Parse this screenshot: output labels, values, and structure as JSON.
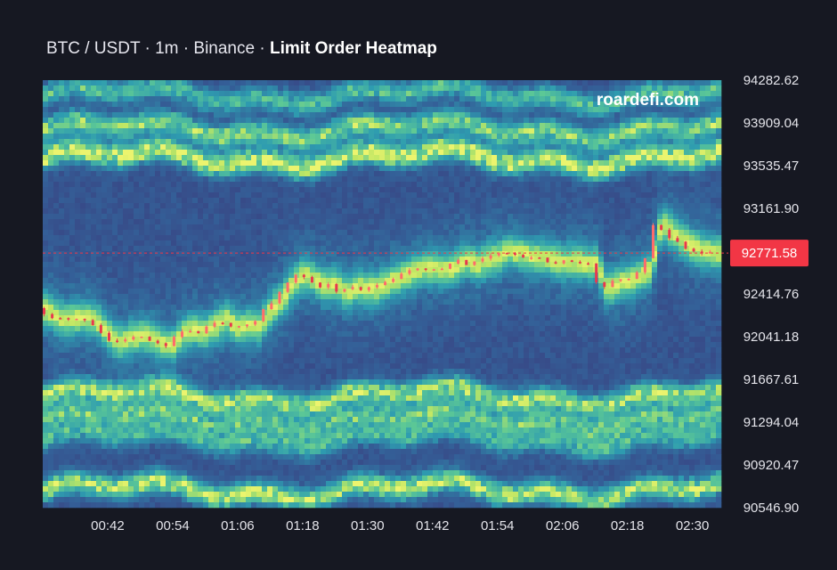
{
  "title": {
    "pair": "BTC / USDT",
    "sep1": " · ",
    "interval": "1m",
    "sep2": " · ",
    "exchange": "Binance",
    "sep3": " · ",
    "name": "Limit Order Heatmap"
  },
  "watermark": "roardefi.com",
  "colors": {
    "background": "#161822",
    "candle_up": "#ff6b6b",
    "candle_down": "#e8384f",
    "current_price_badge": "#f23645",
    "heat_low": "#3b3a7a",
    "heat_mid": "#2f9bb0",
    "heat_high": "#e6f26a"
  },
  "chart_data": {
    "type": "heatmap",
    "title": "BTC / USDT · 1m · Binance · Limit Order Heatmap",
    "ylim": [
      90546.9,
      94282.62
    ],
    "y_ticks": [
      "94282.62",
      "93909.04",
      "93535.47",
      "93161.90",
      "92414.76",
      "92041.18",
      "91667.61",
      "91294.04",
      "90920.47",
      "90546.90"
    ],
    "x_ticks": [
      "00:42",
      "00:54",
      "01:06",
      "01:18",
      "01:30",
      "01:42",
      "01:54",
      "02:06",
      "02:18",
      "02:30"
    ],
    "x_tick_minutes": [
      42,
      54,
      66,
      78,
      90,
      102,
      114,
      126,
      138,
      150
    ],
    "time_range_minutes": [
      30,
      155
    ],
    "current_price": 92771.58,
    "current_price_label": "92771.58",
    "price_series_minutes": [
      30,
      32,
      34,
      36,
      38,
      40,
      42,
      44,
      46,
      48,
      50,
      52,
      54,
      56,
      58,
      60,
      62,
      64,
      66,
      68,
      70,
      72,
      74,
      76,
      78,
      80,
      82,
      84,
      86,
      88,
      90,
      92,
      94,
      96,
      98,
      100,
      102,
      104,
      106,
      108,
      110,
      112,
      114,
      116,
      118,
      120,
      122,
      124,
      126,
      128,
      130,
      132,
      134,
      136,
      138,
      140,
      142,
      144,
      146,
      148,
      150,
      152,
      154
    ],
    "price_series": [
      92290,
      92230,
      92190,
      92200,
      92210,
      92180,
      92070,
      91990,
      92020,
      92050,
      92040,
      91980,
      91970,
      92070,
      92100,
      92080,
      92140,
      92190,
      92120,
      92140,
      92130,
      92270,
      92360,
      92490,
      92580,
      92550,
      92480,
      92500,
      92420,
      92480,
      92460,
      92470,
      92520,
      92560,
      92600,
      92640,
      92640,
      92620,
      92650,
      92710,
      92670,
      92710,
      92740,
      92790,
      92770,
      92740,
      92730,
      92710,
      92690,
      92700,
      92680,
      92680,
      92450,
      92510,
      92530,
      92570,
      92620,
      93030,
      92950,
      92880,
      92820,
      92790,
      92771.58
    ],
    "liquidity_bands": [
      {
        "price": 93600,
        "intensity": 0.9
      },
      {
        "price": 93850,
        "intensity": 0.7
      },
      {
        "price": 94150,
        "intensity": 0.55
      },
      {
        "price": 91520,
        "intensity": 0.75
      },
      {
        "price": 91320,
        "intensity": 0.6
      },
      {
        "price": 91150,
        "intensity": 0.5
      },
      {
        "price": 90700,
        "intensity": 0.8
      }
    ]
  }
}
